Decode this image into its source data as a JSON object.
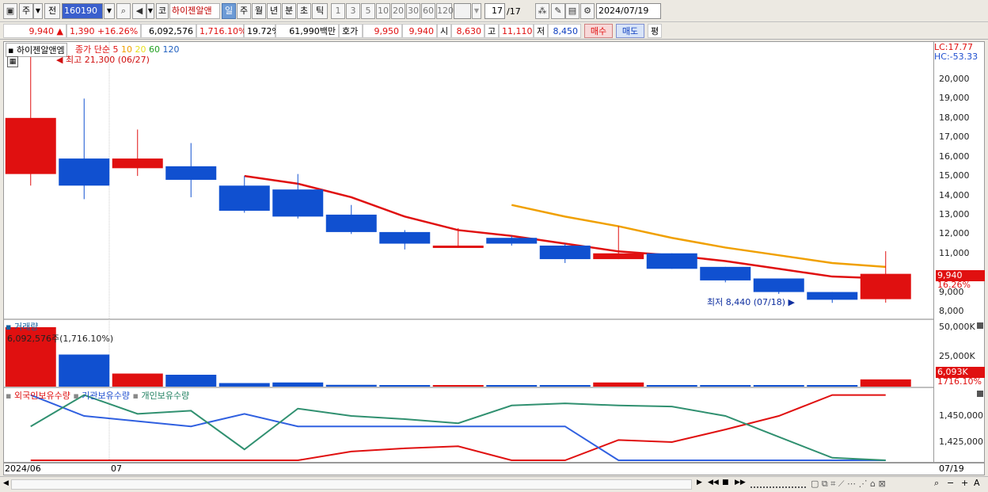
{
  "toolbar": {
    "market_label": "주",
    "prev_label": "전",
    "code_value": "160190",
    "code_prefix": "코",
    "stock_name": "하이젠알앤",
    "periods": [
      "일",
      "주",
      "월",
      "년",
      "분",
      "초",
      "틱"
    ],
    "selected_period": "일",
    "intervals": [
      "1",
      "3",
      "5",
      "10",
      "20",
      "30",
      "60",
      "120"
    ],
    "count_value": "17",
    "count_total": "/17",
    "date_value": "2024/07/19"
  },
  "info": {
    "price": "9,940",
    "change": "1,390",
    "change_rate": "+16.26%",
    "volume": "6,092,576",
    "volume_rate": "1,716.10%",
    "turnover": "19.72%",
    "amount": "61,990백만",
    "ask_label": "호가",
    "ask1": "9,950",
    "ask2": "9,940",
    "open_label": "시",
    "open": "8,630",
    "high_label": "고",
    "high": "11,110",
    "low_label": "저",
    "low": "8,450",
    "buy_label": "매수",
    "sell_label": "매도",
    "eval_label": "평"
  },
  "chart": {
    "title": "하이젠알앤엠",
    "legend_prefix": "종가 단순",
    "ma_periods": [
      "5",
      "10",
      "20",
      "60",
      "120"
    ],
    "ma_colors": [
      "#e01010",
      "#f0a000",
      "#e8e020",
      "#20a020",
      "#2060c0"
    ],
    "lc_label": "LC:17.77",
    "hc_label": "HC:-53.33",
    "high_annot": "최고 21,300 (06/27)",
    "low_annot": "최저 8,440 (07/18)",
    "price_tag": "9,940",
    "rate_tag": "16.26%",
    "volume_title": "거래량",
    "volume_annot": "6,092,576주(1,716.10%)",
    "volume_tag": "6,093K",
    "volume_rate_tag": "1716.10%",
    "holdings_legend": [
      "외국인보유수량",
      "기관보유수량",
      "개인보유수량"
    ],
    "x_start": "2024/06",
    "x_month": "07",
    "x_end": "07/19"
  },
  "chart_data": {
    "type": "candlestick",
    "y_ticks": [
      "20,000",
      "19,000",
      "18,000",
      "17,000",
      "16,000",
      "15,000",
      "14,000",
      "13,000",
      "12,000",
      "11,000",
      "9,000",
      "8,000"
    ],
    "candles": [
      {
        "open": 15100,
        "close": 18000,
        "high": 21300,
        "low": 14500
      },
      {
        "open": 15900,
        "close": 14500,
        "high": 19000,
        "low": 13800
      },
      {
        "open": 15400,
        "close": 15900,
        "high": 17400,
        "low": 15000
      },
      {
        "open": 15500,
        "close": 14800,
        "high": 16700,
        "low": 13900
      },
      {
        "open": 14500,
        "close": 13200,
        "high": 15000,
        "low": 13100
      },
      {
        "open": 14300,
        "close": 12900,
        "high": 15100,
        "low": 12800
      },
      {
        "open": 13000,
        "close": 12100,
        "high": 13500,
        "low": 12000
      },
      {
        "open": 12100,
        "close": 11500,
        "high": 12200,
        "low": 11200
      },
      {
        "open": 11300,
        "close": 11400,
        "high": 12300,
        "low": 11300
      },
      {
        "open": 11800,
        "close": 11500,
        "high": 11900,
        "low": 11400
      },
      {
        "open": 11400,
        "close": 10700,
        "high": 11500,
        "low": 10500
      },
      {
        "open": 10700,
        "close": 11000,
        "high": 12400,
        "low": 10700
      },
      {
        "open": 11000,
        "close": 10200,
        "high": 11000,
        "low": 10200
      },
      {
        "open": 10300,
        "close": 9600,
        "high": 10300,
        "low": 9500
      },
      {
        "open": 9700,
        "close": 9000,
        "high": 9700,
        "low": 8900
      },
      {
        "open": 9000,
        "close": 8600,
        "high": 9000,
        "low": 8440
      },
      {
        "open": 8630,
        "close": 9940,
        "high": 11110,
        "low": 8450
      }
    ],
    "ma5": [
      null,
      null,
      null,
      null,
      15000,
      14600,
      13900,
      12900,
      12200,
      11900,
      11500,
      11100,
      10900,
      10600,
      10200,
      9800,
      9700
    ],
    "ma10": [
      null,
      null,
      null,
      null,
      null,
      null,
      null,
      null,
      null,
      13500,
      12900,
      12400,
      11800,
      11300,
      10900,
      10500,
      10300
    ],
    "volume_ticks": [
      "50,000K",
      "25,000K"
    ],
    "volume": [
      50000,
      27000,
      11000,
      10000,
      3000,
      3500,
      1500,
      1000,
      1200,
      1000,
      1000,
      3500,
      800,
      700,
      600,
      400,
      6093
    ],
    "holdings_ticks": [
      "1,450,000",
      "1,425,000"
    ],
    "foreign": [
      1405000,
      1404000,
      1404000,
      1405000,
      1405500,
      1404500,
      1416000,
      1419000,
      1421000,
      1406000,
      1404000,
      1427000,
      1425000,
      1437000,
      1450000,
      1470000,
      1470000
    ],
    "institution": [
      1470000,
      1450000,
      1445000,
      1440000,
      1452000,
      1440000,
      1440000,
      1440000,
      1440000,
      1440000,
      1440000,
      1405000,
      1405500,
      1405500,
      1405000,
      1405000,
      1403000
    ],
    "individual": [
      1440000,
      1470000,
      1452000,
      1455000,
      1418000,
      1457000,
      1450000,
      1447000,
      1443000,
      1460000,
      1462000,
      1460000,
      1459000,
      1450000,
      1430000,
      1410000,
      1403000
    ]
  }
}
